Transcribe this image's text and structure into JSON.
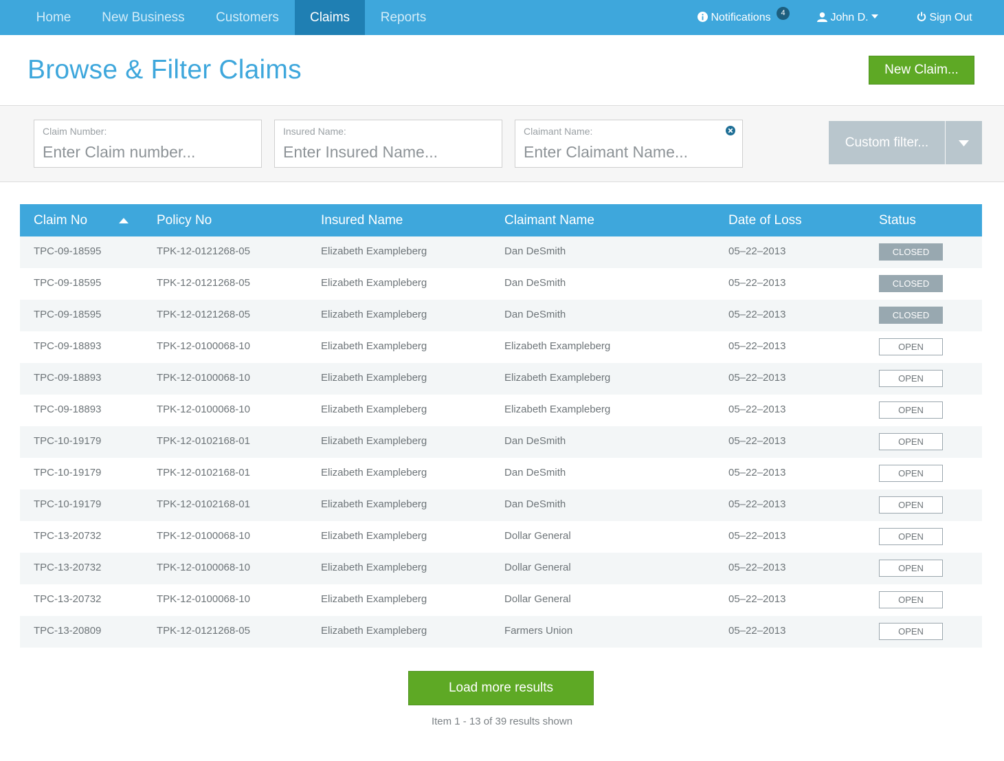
{
  "nav": {
    "items": [
      {
        "label": "Home",
        "active": false
      },
      {
        "label": "New Business",
        "active": false
      },
      {
        "label": "Customers",
        "active": false
      },
      {
        "label": "Claims",
        "active": true
      },
      {
        "label": "Reports",
        "active": false
      }
    ],
    "notifications_label": "Notifications",
    "notifications_count": "4",
    "user_label": "John D.",
    "signout_label": "Sign Out"
  },
  "header": {
    "title": "Browse & Filter Claims",
    "new_claim_label": "New Claim..."
  },
  "filters": {
    "claim_number": {
      "label": "Claim Number:",
      "placeholder": "Enter Claim number..."
    },
    "insured_name": {
      "label": "Insured Name:",
      "placeholder": "Enter Insured Name..."
    },
    "claimant_name": {
      "label": "Claimant Name:",
      "placeholder": "Enter Claimant Name..."
    },
    "custom_filter_label": "Custom filter..."
  },
  "table": {
    "columns": [
      "Claim No",
      "Policy No",
      "Insured Name",
      "Claimant Name",
      "Date of Loss",
      "Status"
    ],
    "sort_column": "Claim No",
    "sort_direction": "ascending",
    "rows": [
      [
        "TPC-09-18595",
        "TPK-12-0121268-05",
        "Elizabeth Exampleberg",
        "Dan DeSmith",
        "05–22–2013",
        "CLOSED"
      ],
      [
        "TPC-09-18595",
        "TPK-12-0121268-05",
        "Elizabeth Exampleberg",
        "Dan DeSmith",
        "05–22–2013",
        "CLOSED"
      ],
      [
        "TPC-09-18595",
        "TPK-12-0121268-05",
        "Elizabeth Exampleberg",
        "Dan DeSmith",
        "05–22–2013",
        "CLOSED"
      ],
      [
        "TPC-09-18893",
        "TPK-12-0100068-10",
        "Elizabeth Exampleberg",
        "Elizabeth Exampleberg",
        "05–22–2013",
        "OPEN"
      ],
      [
        "TPC-09-18893",
        "TPK-12-0100068-10",
        "Elizabeth Exampleberg",
        "Elizabeth Exampleberg",
        "05–22–2013",
        "OPEN"
      ],
      [
        "TPC-09-18893",
        "TPK-12-0100068-10",
        "Elizabeth Exampleberg",
        "Elizabeth Exampleberg",
        "05–22–2013",
        "OPEN"
      ],
      [
        "TPC-10-19179",
        "TPK-12-0102168-01",
        "Elizabeth Exampleberg",
        "Dan DeSmith",
        "05–22–2013",
        "OPEN"
      ],
      [
        "TPC-10-19179",
        "TPK-12-0102168-01",
        "Elizabeth Exampleberg",
        "Dan DeSmith",
        "05–22–2013",
        "OPEN"
      ],
      [
        "TPC-10-19179",
        "TPK-12-0102168-01",
        "Elizabeth Exampleberg",
        "Dan DeSmith",
        "05–22–2013",
        "OPEN"
      ],
      [
        "TPC-13-20732",
        "TPK-12-0100068-10",
        "Elizabeth Exampleberg",
        "Dollar General",
        "05–22–2013",
        "OPEN"
      ],
      [
        "TPC-13-20732",
        "TPK-12-0100068-10",
        "Elizabeth Exampleberg",
        "Dollar General",
        "05–22–2013",
        "OPEN"
      ],
      [
        "TPC-13-20732",
        "TPK-12-0100068-10",
        "Elizabeth Exampleberg",
        "Dollar General",
        "05–22–2013",
        "OPEN"
      ],
      [
        "TPC-13-20809",
        "TPK-12-0121268-05",
        "Elizabeth Exampleberg",
        "Farmers Union",
        "05–22–2013",
        "OPEN"
      ]
    ]
  },
  "footer": {
    "load_more_label": "Load more results",
    "results_info": "Item 1 - 13 of 39 results shown"
  },
  "colors": {
    "brand_blue": "#3ea7dc",
    "active_nav": "#1f7fb3",
    "action_green": "#5ea925",
    "closed_badge": "#98a8b0"
  },
  "icons": {
    "notifications": "info-icon",
    "user": "user-icon",
    "signout": "power-icon",
    "clear": "clear-circle-icon",
    "sort": "sort-asc-icon",
    "dropdown": "caret-down-icon"
  }
}
